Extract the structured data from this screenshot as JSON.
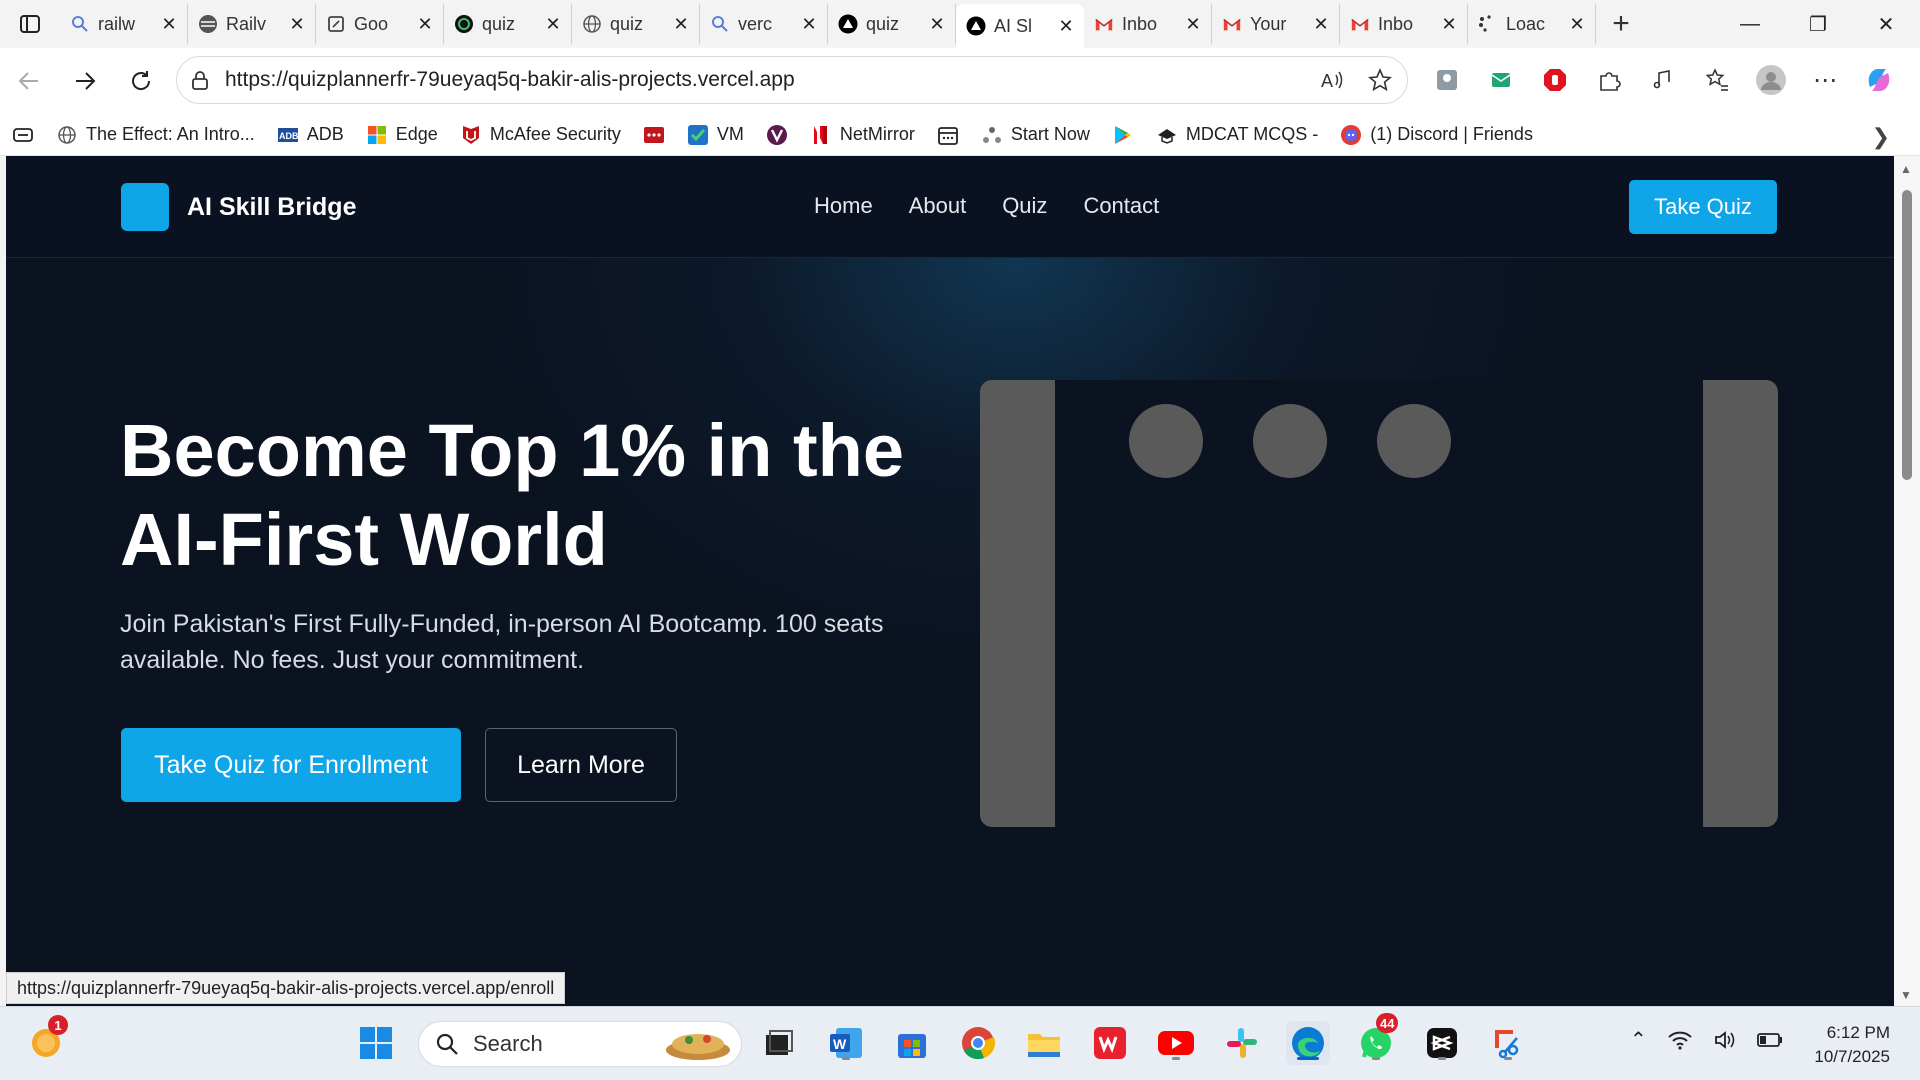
{
  "browser": {
    "tabs": [
      {
        "title": "railw",
        "icon": "search-icon",
        "active": false
      },
      {
        "title": "Railv",
        "icon": "railway-icon",
        "active": false
      },
      {
        "title": "Goo",
        "icon": "google-doc-icon",
        "active": false
      },
      {
        "title": "quiz",
        "icon": "openai-icon",
        "active": false
      },
      {
        "title": "quiz",
        "icon": "globe-icon",
        "active": false
      },
      {
        "title": "verc",
        "icon": "search-icon",
        "active": false
      },
      {
        "title": "quiz",
        "icon": "vercel-icon",
        "active": false
      },
      {
        "title": "AI Sl",
        "icon": "vercel-icon",
        "active": true
      },
      {
        "title": "Inbo",
        "icon": "gmail-icon",
        "active": false
      },
      {
        "title": "Your",
        "icon": "gmail-icon",
        "active": false
      },
      {
        "title": "Inbo",
        "icon": "gmail-icon",
        "active": false
      },
      {
        "title": "Loac",
        "icon": "loading-icon",
        "active": false
      }
    ],
    "url": "https://quizplannerfr-79ueyaq5q-bakir-alis-projects.vercel.app",
    "favorites": [
      {
        "label": "",
        "icon": "reading-list-icon"
      },
      {
        "label": "The Effect: An Intro...",
        "icon": "globe-icon"
      },
      {
        "label": "ADB",
        "icon": "adb-icon"
      },
      {
        "label": "Edge",
        "icon": "microsoft-icon"
      },
      {
        "label": "McAfee Security",
        "icon": "mcafee-icon"
      },
      {
        "label": "",
        "icon": "red-dots-icon"
      },
      {
        "label": "VM",
        "icon": "vm-check-icon"
      },
      {
        "label": "",
        "icon": "v-logo-icon"
      },
      {
        "label": "NetMirror",
        "icon": "netmirror-icon"
      },
      {
        "label": "",
        "icon": "calendar-icon"
      },
      {
        "label": "Start Now",
        "icon": "start-icon"
      },
      {
        "label": "",
        "icon": "play-store-icon"
      },
      {
        "label": "MDCAT MCQS -",
        "icon": "mdcat-icon"
      },
      {
        "label": "(1) Discord | Friends",
        "icon": "discord-icon"
      }
    ],
    "status_url": "https://quizplannerfr-79ueyaq5q-bakir-alis-projects.vercel.app/enroll"
  },
  "site": {
    "brand": "AI Skill Bridge",
    "nav": [
      "Home",
      "About",
      "Quiz",
      "Contact"
    ],
    "header_cta": "Take Quiz",
    "hero": {
      "title_line1": "Become Top 1% in the",
      "title_line2": "AI-First World",
      "subtitle": "Join Pakistan's First Fully-Funded, in-person AI Bootcamp. 100 seats available. No fees. Just your commitment.",
      "primary_cta": "Take Quiz for Enrollment",
      "secondary_cta": "Learn More"
    }
  },
  "taskbar": {
    "search_placeholder": "Search",
    "notification_count": "1",
    "whatsapp_badge": "44",
    "time": "6:12 PM",
    "date": "10/7/2025"
  },
  "colors": {
    "accent": "#0ea5e9",
    "page_bg": "#0b1220",
    "placeholder_gray": "#5a5a5a"
  }
}
